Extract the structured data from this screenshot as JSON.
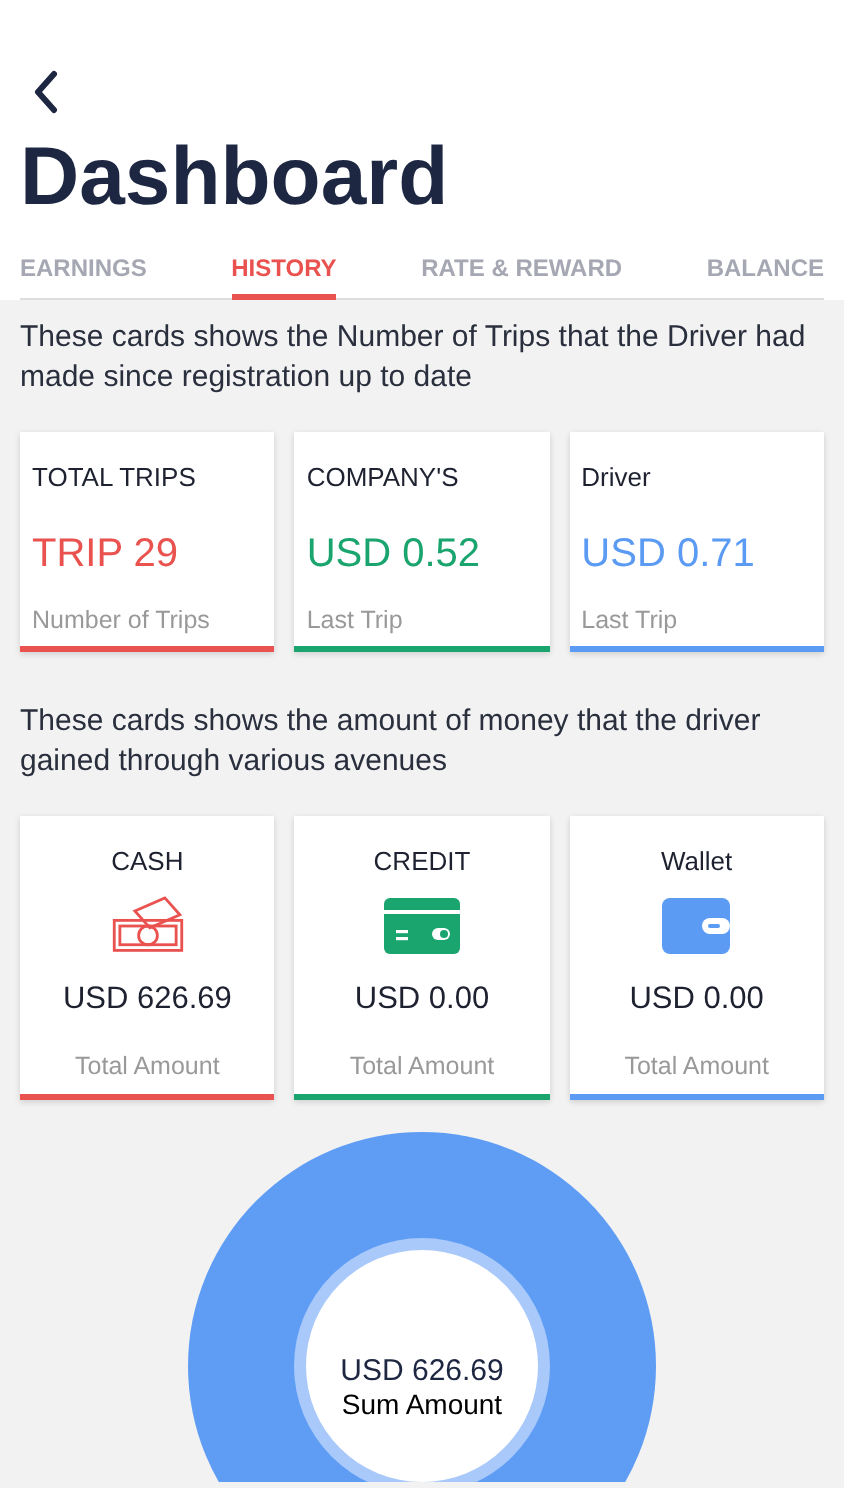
{
  "title": "Dashboard",
  "tabs": [
    {
      "label": "EARNINGS",
      "selected": false
    },
    {
      "label": "HISTORY",
      "selected": true
    },
    {
      "label": "RATE & REWARD",
      "selected": false
    },
    {
      "label": "BALANCE",
      "selected": false
    }
  ],
  "trips_section": {
    "description": "These cards shows the Number of Trips that the Driver had made since registration up to date",
    "cards": [
      {
        "heading": "TOTAL TRIPS",
        "value": "TRIP 29",
        "caption": "Number of Trips",
        "color": "#e9524f"
      },
      {
        "heading": "COMPANY'S",
        "value": "USD 0.52",
        "caption": "Last Trip",
        "color": "#1aa46e"
      },
      {
        "heading": "Driver",
        "value": "USD 0.71",
        "caption": "Last Trip",
        "color": "#5b9bf3"
      }
    ]
  },
  "money_section": {
    "description": "These cards shows the amount of money that the driver gained through various avenues",
    "cards": [
      {
        "kind": "cash",
        "heading": "CASH",
        "value": "USD 626.69",
        "caption": "Total Amount",
        "color": "#e9524f"
      },
      {
        "kind": "credit",
        "heading": "CREDIT",
        "value": "USD 0.00",
        "caption": "Total Amount",
        "color": "#1aa46e"
      },
      {
        "kind": "wallet",
        "heading": "Wallet",
        "value": "USD 0.00",
        "caption": "Total Amount",
        "color": "#5b9bf3"
      }
    ]
  },
  "summary": {
    "amount": "USD 626.69",
    "label": "Sum Amount"
  }
}
